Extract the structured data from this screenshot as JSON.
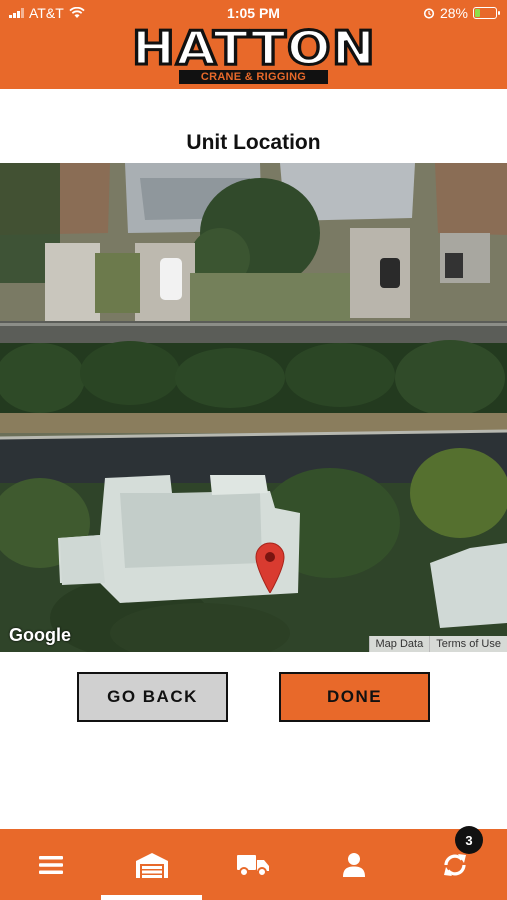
{
  "status_bar": {
    "carrier": "AT&T",
    "time": "1:05 PM",
    "battery": "28%",
    "battery_level": 0.28
  },
  "header": {
    "logo_text": "HATTON",
    "logo_subtext": "CRANE & RIGGING",
    "brand_color": "#e8692a"
  },
  "page": {
    "title": "Unit Location"
  },
  "map": {
    "provider_logo": "Google",
    "attribution_links": [
      "Map Data",
      "Terms of Use"
    ],
    "marker_icon": "map-pin-icon"
  },
  "actions": {
    "back_label": "GO BACK",
    "done_label": "DONE"
  },
  "tab_bar": {
    "tabs": [
      {
        "icon": "menu-icon",
        "active": false
      },
      {
        "icon": "garage-icon",
        "active": true
      },
      {
        "icon": "truck-icon",
        "active": false
      },
      {
        "icon": "user-icon",
        "active": false
      },
      {
        "icon": "sync-icon",
        "active": false,
        "badge": "3"
      }
    ]
  }
}
